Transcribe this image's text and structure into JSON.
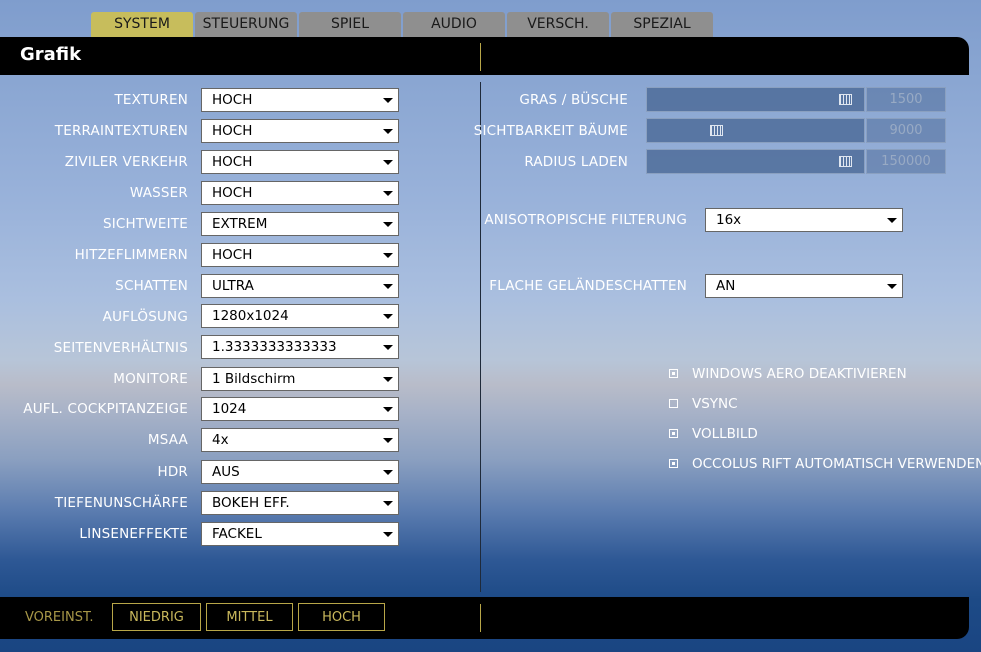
{
  "tabs": [
    "SYSTEM",
    "STEUERUNG",
    "SPIEL",
    "AUDIO",
    "VERSCH.",
    "SPEZIAL"
  ],
  "active_tab": "SYSTEM",
  "header": {
    "title": "Grafik"
  },
  "left_settings": [
    {
      "label": "TEXTUREN",
      "value": "HOCH"
    },
    {
      "label": "TERRAINTEXTUREN",
      "value": "HOCH"
    },
    {
      "label": "ZIVILER VERKEHR",
      "value": "HOCH"
    },
    {
      "label": "WASSER",
      "value": "HOCH"
    },
    {
      "label": "SICHTWEITE",
      "value": "EXTREM"
    },
    {
      "label": "HITZEFLIMMERN",
      "value": "HOCH"
    },
    {
      "label": "SCHATTEN",
      "value": "ULTRA"
    },
    {
      "label": "AUFLÖSUNG",
      "value": "1280x1024"
    },
    {
      "label": "SEITENVERHÄLTNIS",
      "value": "1.3333333333333"
    },
    {
      "label": "MONITORE",
      "value": "1 Bildschirm"
    },
    {
      "label": "AUFL. COCKPITANZEIGE",
      "value": "1024"
    },
    {
      "label": "MSAA",
      "value": "4x"
    },
    {
      "label": "HDR",
      "value": "AUS"
    },
    {
      "label": "TIEFENUNSCHÄRFE",
      "value": "BOKEH EFF."
    },
    {
      "label": "LINSENEFFEKTE",
      "value": "FACKEL"
    }
  ],
  "sliders": [
    {
      "label": "GRAS / BÜSCHE",
      "value": "1500",
      "fraction": 0.94
    },
    {
      "label": "SICHTBARKEIT BÄUME",
      "value": "9000",
      "fraction": 0.31
    },
    {
      "label": "RADIUS LADEN",
      "value": "150000",
      "fraction": 0.94
    }
  ],
  "aniso": {
    "label": "ANISOTROPISCHE FILTERUNG",
    "value": "16x"
  },
  "flat_shadows": {
    "label": "FLACHE GELÄNDESCHATTEN",
    "value": "AN"
  },
  "checkboxes": [
    {
      "label": "WINDOWS AERO DEAKTIVIEREN",
      "checked": true
    },
    {
      "label": "VSYNC",
      "checked": false
    },
    {
      "label": "VOLLBILD",
      "checked": true
    },
    {
      "label": "OCCOLUS RIFT AUTOMATISCH VERWENDEN",
      "checked": true
    }
  ],
  "footer": {
    "presets_label": "VOREINST.",
    "buttons": [
      "NIEDRIG",
      "MITTEL",
      "HOCH"
    ]
  },
  "colors": {
    "active_tab": "#c7bd5c",
    "tab": "#8f8f8f",
    "accent": "#b8a648"
  }
}
